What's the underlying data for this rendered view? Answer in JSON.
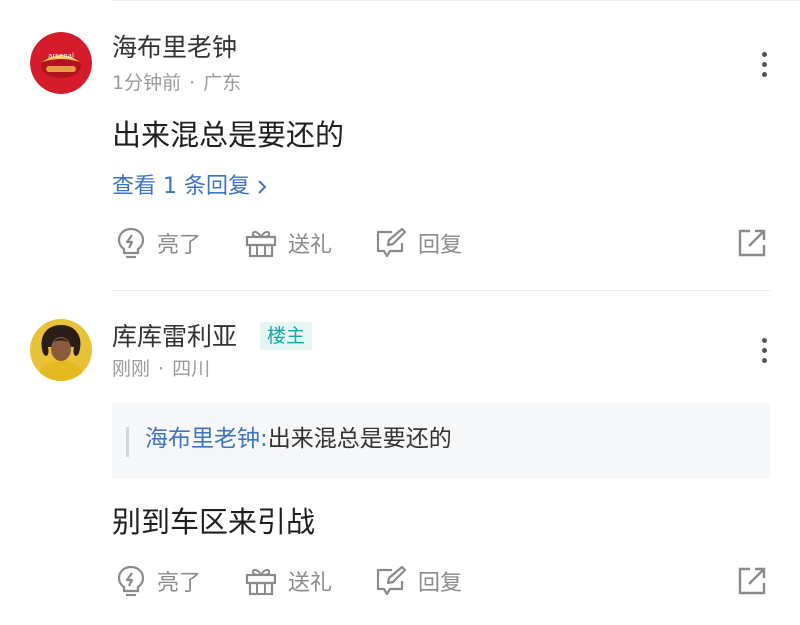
{
  "comments": [
    {
      "username": "海布里老钟",
      "time": "1分钟前",
      "location": "广东",
      "content": "出来混总是要还的",
      "view_replies": "查看 1 条回复",
      "actions": {
        "like": "亮了",
        "gift": "送礼",
        "reply": "回复"
      }
    },
    {
      "username": "库库雷利亚",
      "badge": "楼主",
      "time": "刚刚",
      "location": "四川",
      "quote": {
        "author": "海布里老钟:",
        "text": "出来混总是要还的"
      },
      "content": "别到车区来引战",
      "actions": {
        "like": "亮了",
        "gift": "送礼",
        "reply": "回复"
      }
    }
  ],
  "meta_separator": "·",
  "icons": [
    "lightbulb-icon",
    "gift-icon",
    "edit-reply-icon",
    "share-icon",
    "more-vertical-icon",
    "chevron-right-icon"
  ],
  "colors": {
    "link_blue": "#3d74c5",
    "badge_teal": "#14a8a0",
    "avatar1_red": "#d51c2b"
  }
}
